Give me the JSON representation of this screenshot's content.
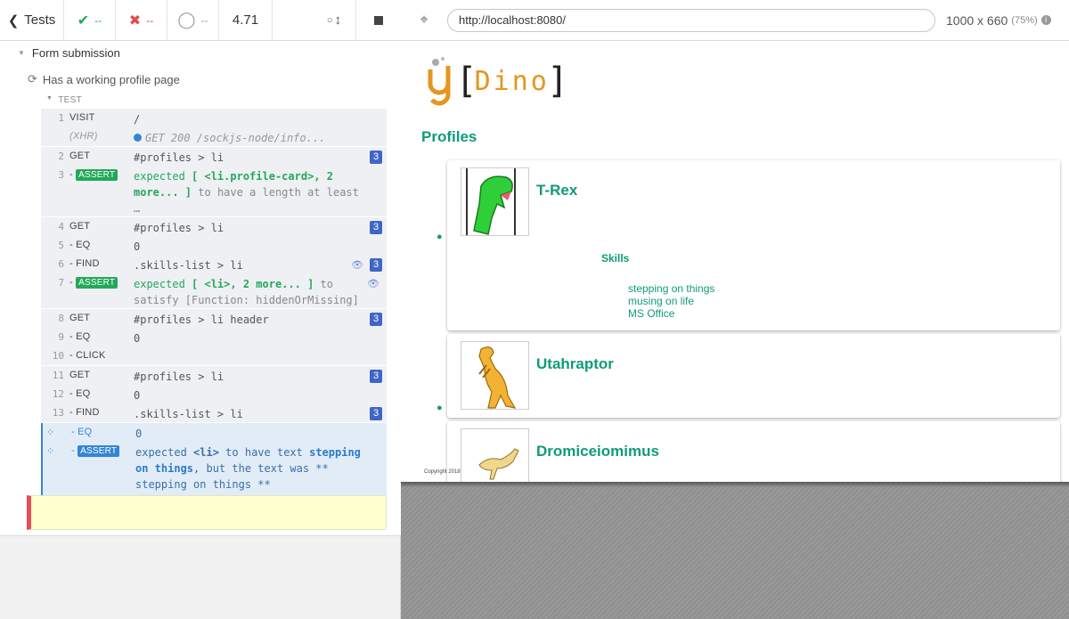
{
  "toolbar": {
    "tests_label": "Tests",
    "passed": "--",
    "failed": "--",
    "pending": "--",
    "duration": "4.71"
  },
  "reporter": {
    "suite_title": "Form submission",
    "test_title": "Has a working profile page",
    "section_label": "TEST",
    "commands": [
      {
        "num": "1",
        "name": "VISIT",
        "msg": "/"
      },
      {
        "num": "",
        "name": "(XHR)",
        "msg": "GET 200 /sockjs-node/info..."
      },
      {
        "num": "2",
        "name": "GET",
        "msg": "#profiles > li",
        "badge": "3"
      },
      {
        "num": "3",
        "name": "- ASSERT",
        "msg": "expected [ <li.profile-card>, 2 more... ] to have a length at least …"
      },
      {
        "num": "4",
        "name": "GET",
        "msg": "#profiles > li",
        "badge": "3"
      },
      {
        "num": "5",
        "name": "- EQ",
        "msg": "0"
      },
      {
        "num": "6",
        "name": "- FIND",
        "msg": ".skills-list > li",
        "badge": "3"
      },
      {
        "num": "7",
        "name": "- ASSERT",
        "msg": "expected [ <li>, 2 more... ] to satisfy [Function: hiddenOrMissing]"
      },
      {
        "num": "8",
        "name": "GET",
        "msg": "#profiles > li header",
        "badge": "3"
      },
      {
        "num": "9",
        "name": "- EQ",
        "msg": "0"
      },
      {
        "num": "10",
        "name": "- CLICK",
        "msg": ""
      },
      {
        "num": "11",
        "name": "GET",
        "msg": "#profiles > li",
        "badge": "3"
      },
      {
        "num": "12",
        "name": "- EQ",
        "msg": "0"
      },
      {
        "num": "13",
        "name": "- FIND",
        "msg": ".skills-list > li",
        "badge": "3"
      },
      {
        "num": "",
        "name": "- EQ",
        "msg": "0"
      },
      {
        "num": "",
        "name": "- ASSERT",
        "msg": "expected <li> to have text stepping on things , but the text was ** stepping on things **"
      }
    ],
    "assert_tag": "ASSERT",
    "cmd3_a": "expected",
    "cmd3_b": "[ <li.profile-card>, 2 more... ]",
    "cmd3_c": "to have a length at least …",
    "cmd7_a": "expected",
    "cmd7_b": "[ <li>, 2 more... ]",
    "cmd7_c": "to satisfy [Function: hiddenOrMissing]",
    "last_a": "expected",
    "last_b": "<li>",
    "last_c": "to have text",
    "last_d": "stepping on things",
    "last_e": ", but the text was ** stepping on things **"
  },
  "browser": {
    "url": "http://localhost:8080/",
    "viewport": "1000 x 660",
    "zoom": "(75%)"
  },
  "app": {
    "logo_text": "Dino",
    "heading": "Profiles",
    "profiles": [
      {
        "name": "T-Rex"
      },
      {
        "name": "Utahraptor"
      },
      {
        "name": "Dromiceiomimus"
      }
    ],
    "skills_heading": "Skills",
    "skills": [
      "stepping on things",
      "musing on life",
      "MS Office"
    ],
    "copyright": "Copyright 2018"
  },
  "colors": {
    "accent": "#0f9b79",
    "pass": "#23a85b",
    "fail": "#e14b4b",
    "badge": "#3f66c7",
    "logo": "#e6951f"
  }
}
